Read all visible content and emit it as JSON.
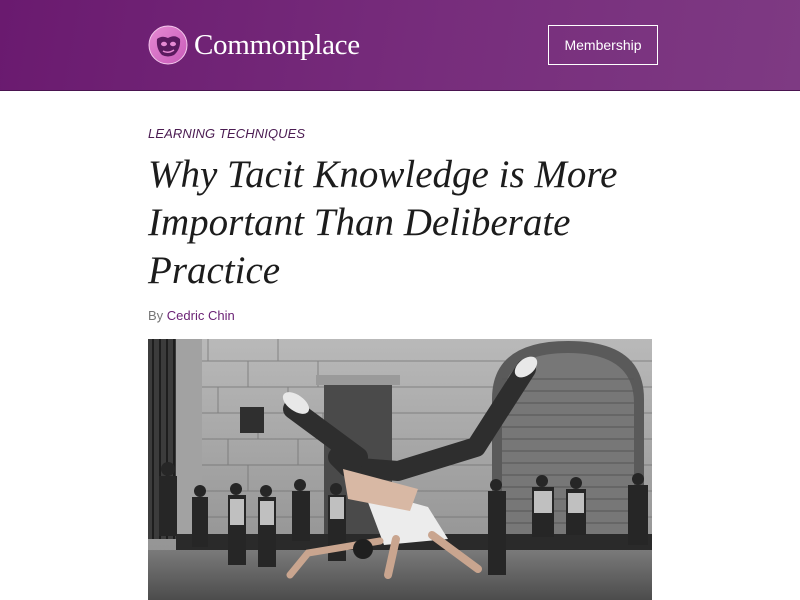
{
  "header": {
    "brand_name": "Commonplace",
    "membership_label": "Membership",
    "logo_icon": "commonplace-logo-icon",
    "colors": {
      "background": "#6f2274",
      "text": "#ffffff"
    }
  },
  "article": {
    "category": "LEARNING TECHNIQUES",
    "title": "Why Tacit Knowledge is More Important Than Deliberate Practice",
    "byline_prefix": "By",
    "author": "Cedric Chin",
    "colors": {
      "category": "#4b1c52",
      "author_link": "#6b2275",
      "title": "#1c1c1c"
    }
  },
  "hero_image": {
    "subject": "black-and-white photo of a breakdancer upside down in front of a stone building with onlookers"
  }
}
